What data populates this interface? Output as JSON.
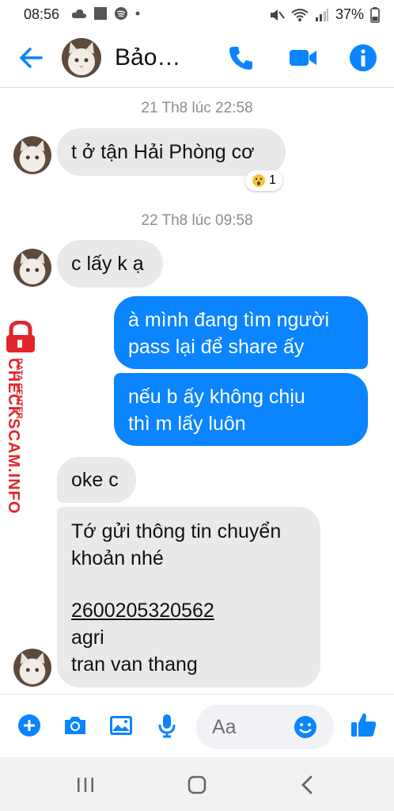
{
  "status_bar": {
    "time": "08:56",
    "battery": "37%"
  },
  "header": {
    "contact_name": "Bảo…"
  },
  "messages": {
    "ts1": "21 Th8 lúc 22:58",
    "m1": "t ở tận Hải Phòng cơ",
    "reaction_count": "1",
    "ts2": "22 Th8 lúc 09:58",
    "m2": "c lấy k ạ",
    "m3_l1": "à mình đang tìm người",
    "m3_l2": "pass lại để share ấy",
    "m4_l1": "nếu b ấy không chịu",
    "m4_l2": "thì m lấy luôn",
    "m5": "oke c",
    "m6_l1": "Tớ gửi thông tin chuyển",
    "m6_l2": "khoản nhé",
    "m6_account": "2600205320562",
    "m6_bank": "agri",
    "m6_name": "tran van thang"
  },
  "watermark": {
    "brand": "CHECKSCAM.INFO",
    "sub": "DATA CENTER"
  },
  "composer": {
    "placeholder": "Aa"
  },
  "colors": {
    "accent": "#0a84ff",
    "incoming_bubble": "#e9e9eb",
    "watermark": "#e0262a"
  }
}
